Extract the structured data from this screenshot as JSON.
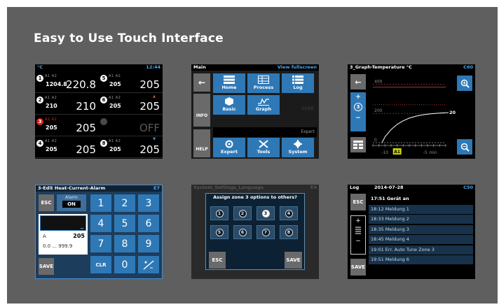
{
  "headline": "Easy to Use Touch Interface",
  "colors": {
    "slide_bg": "#5f5f5f",
    "accent_blue": "#2f78b6",
    "alarm_red": "#e02020",
    "curve": "#ffffff"
  },
  "overview": {
    "unit": "°C",
    "time": "12:44",
    "zones": [
      {
        "num": "1",
        "tags": "A1 A2",
        "set": "1204.8",
        "actual": "220.8",
        "state": "normal"
      },
      {
        "num": "5",
        "tags": "A1 A2",
        "set": "205",
        "actual": "205",
        "state": "normal"
      },
      {
        "num": "2",
        "tags": "A1 A2",
        "set": "210",
        "actual": "210",
        "state": "normal"
      },
      {
        "num": "6",
        "tags": "A1 A2",
        "set": "205",
        "actual": "205",
        "state": "normal",
        "mark": "up"
      },
      {
        "num": "3",
        "tags": "A1 A2",
        "set": "205",
        "actual": "205",
        "state": "alarm"
      },
      {
        "num": "",
        "tags": "",
        "set": "",
        "actual": "OFF",
        "state": "off"
      },
      {
        "num": "4",
        "tags": "A1 A2",
        "set": "205",
        "actual": "205",
        "state": "normal"
      },
      {
        "num": "8",
        "tags": "A1 A2",
        "set": "205",
        "actual": "205",
        "state": "normal",
        "mark": "down"
      }
    ]
  },
  "main_menu": {
    "title": "Main",
    "view_fullscreen": "View fullscreen",
    "back_icon": "back-arrow-icon",
    "info": "INFO",
    "help": "HELP",
    "user": "USER",
    "expert_label": "Expert",
    "tiles": [
      {
        "label": "Home",
        "icon": "home-list-icon"
      },
      {
        "label": "Process",
        "icon": "process-table-icon"
      },
      {
        "label": "Log",
        "icon": "log-list-icon"
      },
      {
        "label": "Basic",
        "icon": "hexagon-icon"
      },
      {
        "label": "Graph",
        "icon": "graph-icon"
      },
      {
        "label": "Expert",
        "icon": "expert-gear-icon"
      },
      {
        "label": "Tools",
        "icon": "tools-icon"
      },
      {
        "label": "System",
        "icon": "system-gear-icon"
      }
    ]
  },
  "graph": {
    "title": "3_Graph-Temperature °C",
    "code": "C60",
    "zone": "3",
    "plus": "+",
    "minus": "−",
    "y_ticks": [
      "400",
      "200",
      "0"
    ],
    "x_ticks": [
      "-10",
      "-5",
      "min"
    ],
    "x_marker": "A1",
    "value": "205"
  },
  "chart_data": {
    "type": "line",
    "title": "3_Graph-Temperature °C",
    "xlabel": "min",
    "ylabel": "°C",
    "xlim": [
      -12,
      0
    ],
    "ylim": [
      0,
      450
    ],
    "series": [
      {
        "x": [
          -10.5,
          -10,
          -9,
          -8,
          -7,
          -6,
          -5,
          -4,
          -3,
          -2,
          -1,
          0
        ],
        "y": [
          0,
          40,
          90,
          125,
          150,
          168,
          180,
          189,
          195,
          199,
          202,
          205
        ]
      }
    ]
  },
  "edit": {
    "title": "3-Edit Heat-Current-Alarm",
    "code": "E7",
    "esc": "ESC",
    "alarm_label": "Alarm",
    "alarm_value": "ON",
    "input_cursor": "_",
    "unit": "A",
    "current": "205",
    "range": "0.0 ... 999.9",
    "save": "SAVE",
    "clr": "CLR",
    "keys": [
      "1",
      "2",
      "3",
      "4",
      "5",
      "6",
      "7",
      "8",
      "9",
      "0"
    ],
    "sign_key": "+/-"
  },
  "assign": {
    "bg_title": "System_Settings_Language",
    "bg_code": "E4",
    "question": "Assign zone 3 options to others?",
    "options": [
      "1",
      "2",
      "3",
      "4",
      "5",
      "6",
      "7",
      "8"
    ],
    "selected": "3",
    "esc": "ESC",
    "save": "SAVE"
  },
  "log": {
    "title": "Log",
    "date": "2014-07-28",
    "code": "C50",
    "esc": "ESC",
    "save": "SAVE",
    "plus": "+",
    "minus": "−",
    "entries": [
      "17:51 Gerät an",
      "18:12 Meldung 1",
      "18:33 Meldung 2",
      "18:35 Meldung 3",
      "18:45 Meldung 4",
      "19:01 Err. Auto Tune Zone 3",
      "19:51 Meldung 6"
    ]
  }
}
